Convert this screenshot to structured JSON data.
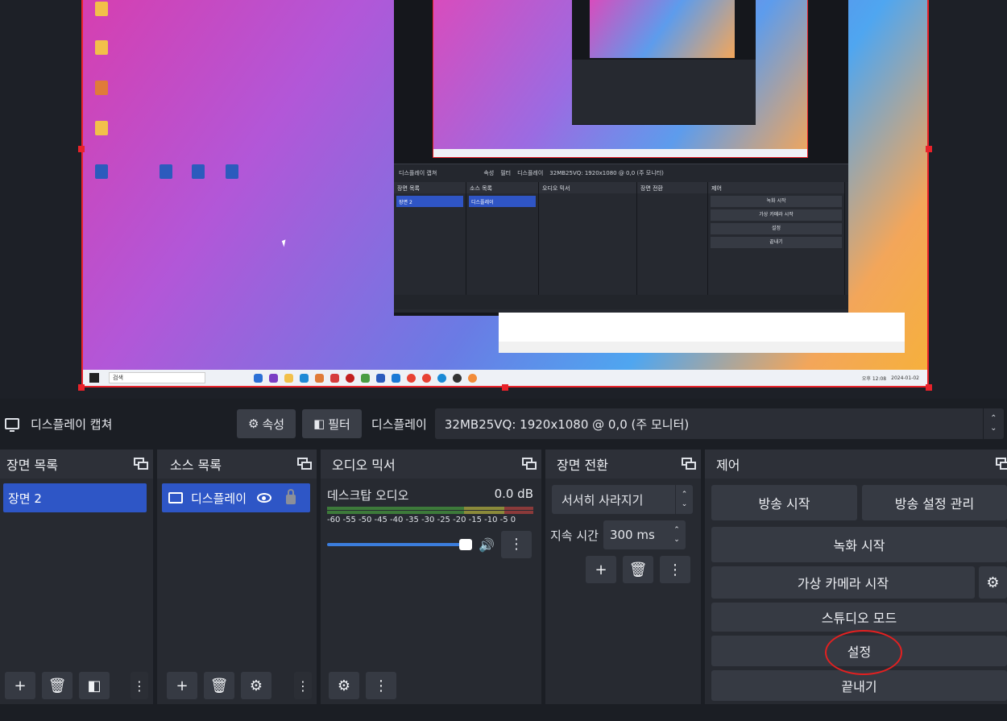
{
  "context_bar": {
    "source_name": "디스플레이 캡쳐",
    "properties_label": "속성",
    "filters_label": "필터",
    "display_label": "디스플레이",
    "display_value": "32MB25VQ: 1920x1080 @ 0,0 (주 모니터)"
  },
  "scenes": {
    "title": "장면 목록",
    "items": [
      "장면 2"
    ]
  },
  "sources": {
    "title": "소스 목록",
    "items": [
      "디스플레이"
    ]
  },
  "mixer": {
    "title": "오디오 믹서",
    "channel": "데스크탑 오디오",
    "level": "0.0 dB",
    "ticks": "-60 -55 -50 -45 -40 -35 -30 -25 -20 -15 -10 -5  0",
    "volume_fraction": 1.0
  },
  "transitions": {
    "title": "장면 전환",
    "selected": "서서히 사라지기",
    "duration_label": "지속 시간",
    "duration_value": "300 ms"
  },
  "controls": {
    "title": "제어",
    "start_stream": "방송 시작",
    "stream_settings": "방송 설정 관리",
    "start_recording": "녹화 시작",
    "start_virtual_cam": "가상 카메라 시작",
    "studio_mode": "스튜디오 모드",
    "settings": "설정",
    "exit": "끝내기"
  },
  "desktop": {
    "search_placeholder": "검색",
    "clock_time": "오후 12:08",
    "clock_date": "2024-01-02"
  },
  "icons": [
    "monitor-icon",
    "gear-icon",
    "filter-icon",
    "plus-icon",
    "trash-icon",
    "dots-icon",
    "eye-icon",
    "lock-icon",
    "speaker-icon",
    "undock-icon"
  ],
  "colors": {
    "accent": "#2e56c6",
    "selection_border": "#e8222a",
    "panel": "#272a31",
    "button": "#363a43"
  }
}
